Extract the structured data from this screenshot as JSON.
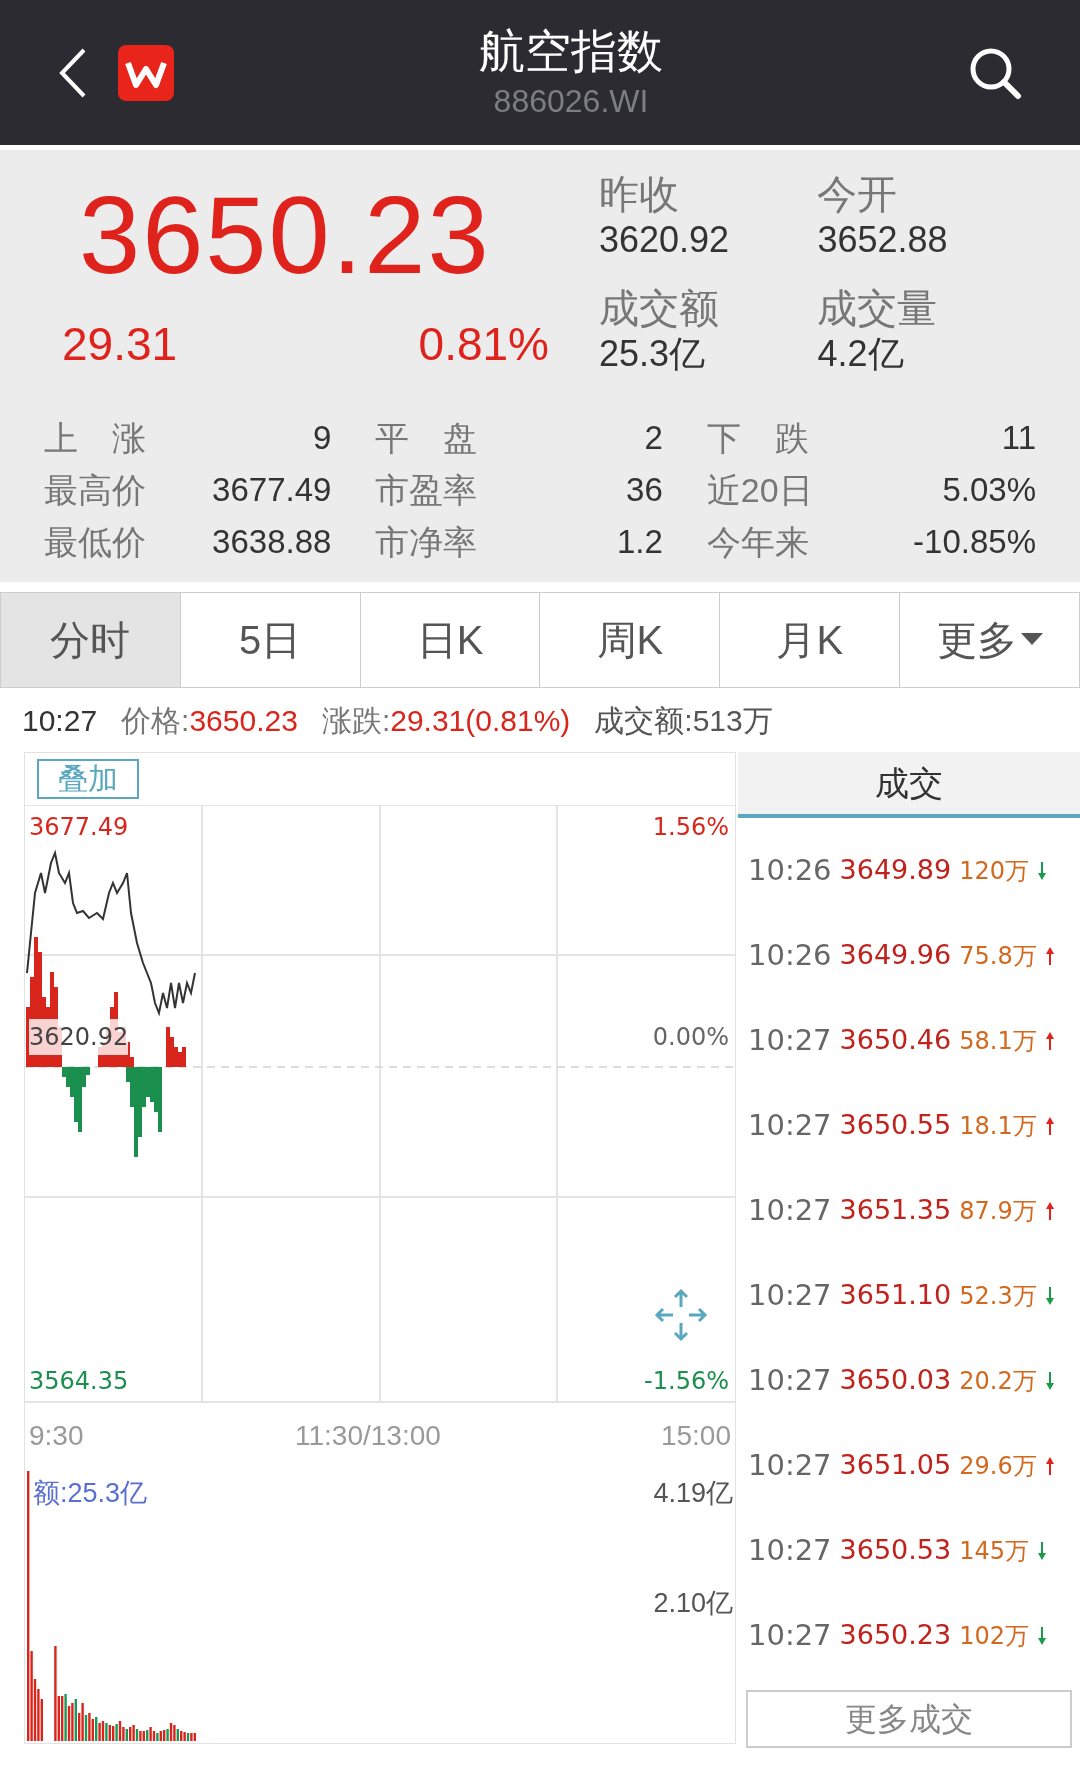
{
  "header": {
    "title": "航空指数",
    "code": "886026.WI"
  },
  "quote": {
    "price": "3650.23",
    "change": "29.31",
    "change_pct": "0.81%",
    "fields": [
      {
        "label": "昨收",
        "value": "3620.92"
      },
      {
        "label": "今开",
        "value": "3652.88"
      },
      {
        "label": "成交额",
        "value": "25.3亿"
      },
      {
        "label": "成交量",
        "value": "4.2亿"
      }
    ],
    "stats": [
      [
        {
          "label": "上　涨",
          "value": "9"
        },
        {
          "label": "平　盘",
          "value": "2"
        },
        {
          "label": "下　跌",
          "value": "11"
        }
      ],
      [
        {
          "label": "最高价",
          "value": "3677.49"
        },
        {
          "label": "市盈率",
          "value": "36"
        },
        {
          "label": "近20日",
          "value": "5.03%"
        }
      ],
      [
        {
          "label": "最低价",
          "value": "3638.88"
        },
        {
          "label": "市净率",
          "value": "1.2"
        },
        {
          "label": "今年来",
          "value": "-10.85%"
        }
      ]
    ]
  },
  "tabs": [
    {
      "label": "分时",
      "selected": true
    },
    {
      "label": "5日",
      "selected": false
    },
    {
      "label": "日K",
      "selected": false
    },
    {
      "label": "周K",
      "selected": false
    },
    {
      "label": "月K",
      "selected": false
    },
    {
      "label": "更多",
      "selected": false,
      "dropdown": true
    }
  ],
  "info": {
    "time": "10:27",
    "price_label": "价格:",
    "price": "3650.23",
    "change_label": "涨跌:",
    "change": "29.31(0.81%)",
    "amount": "成交额:513万"
  },
  "chart": {
    "overlay_button": "叠加",
    "high": "3677.49",
    "mid": "3620.92",
    "low": "3564.35",
    "pct_high": "1.56%",
    "pct_mid": "0.00%",
    "pct_low": "-1.56%",
    "x_start": "9:30",
    "x_mid": "11:30/13:00",
    "x_end": "15:00",
    "volume_label": "额:25.3亿",
    "vol_high": "4.19亿",
    "vol_mid": "2.10亿"
  },
  "trades": {
    "title": "成交",
    "more_button": "更多成交",
    "rows": [
      {
        "time": "10:26",
        "price": "3649.89",
        "volume": "120万",
        "kind": "down"
      },
      {
        "time": "10:26",
        "price": "3649.96",
        "volume": "75.8万",
        "kind": "up"
      },
      {
        "time": "10:27",
        "price": "3650.46",
        "volume": "58.1万",
        "kind": "up"
      },
      {
        "time": "10:27",
        "price": "3650.55",
        "volume": "18.1万",
        "kind": "up"
      },
      {
        "time": "10:27",
        "price": "3651.35",
        "volume": "87.9万",
        "kind": "up"
      },
      {
        "time": "10:27",
        "price": "3651.10",
        "volume": "52.3万",
        "kind": "down"
      },
      {
        "time": "10:27",
        "price": "3650.03",
        "volume": "20.2万",
        "kind": "down"
      },
      {
        "time": "10:27",
        "price": "3651.05",
        "volume": "29.6万",
        "kind": "up"
      },
      {
        "time": "10:27",
        "price": "3650.53",
        "volume": "145万",
        "kind": "down"
      },
      {
        "time": "10:27",
        "price": "3650.23",
        "volume": "102万",
        "kind": "down"
      }
    ]
  }
}
